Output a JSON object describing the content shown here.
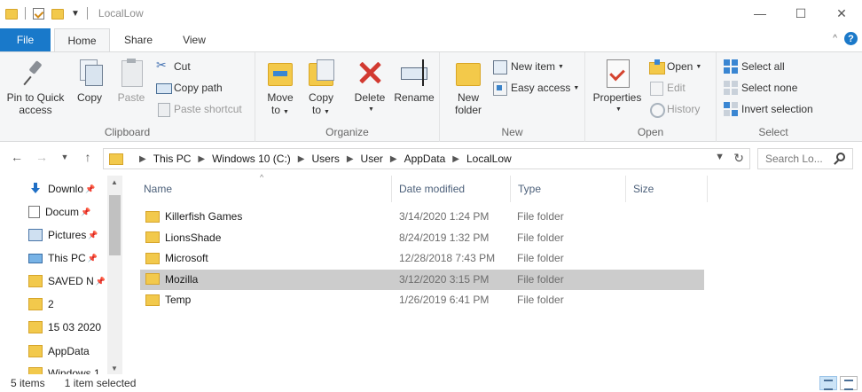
{
  "window": {
    "title": "LocalLow",
    "minimize_glyph": "—",
    "maximize_glyph": "☐",
    "close_glyph": "✕"
  },
  "tabs": [
    "File",
    "Home",
    "Share",
    "View"
  ],
  "help_glyph": "?",
  "ribbon_collapse_glyph": "^",
  "ribbon": {
    "clipboard": {
      "label": "Clipboard",
      "pin_line1": "Pin to Quick",
      "pin_line2": "access",
      "copy": "Copy",
      "paste": "Paste",
      "cut": "Cut",
      "copy_path": "Copy path",
      "paste_shortcut": "Paste shortcut"
    },
    "organize": {
      "label": "Organize",
      "move_line1": "Move",
      "move_line2": "to",
      "copy_line1": "Copy",
      "copy_line2": "to",
      "delete": "Delete",
      "rename": "Rename"
    },
    "new": {
      "label": "New",
      "new_folder_line1": "New",
      "new_folder_line2": "folder",
      "new_item": "New item",
      "easy_access": "Easy access"
    },
    "open": {
      "label": "Open",
      "properties": "Properties",
      "open": "Open",
      "edit": "Edit",
      "history": "History"
    },
    "select": {
      "label": "Select",
      "select_all": "Select all",
      "select_none": "Select none",
      "invert_selection": "Invert selection"
    }
  },
  "address": {
    "crumbs": [
      "This PC",
      "Windows 10 (C:)",
      "Users",
      "User",
      "AppData",
      "LocalLow"
    ],
    "search_placeholder": "Search Lo..."
  },
  "nav_pane": {
    "items": [
      {
        "label": "Downlo",
        "icon": "download-icon",
        "pinned": true
      },
      {
        "label": "Docum",
        "icon": "document-icon",
        "pinned": true
      },
      {
        "label": "Pictures",
        "icon": "pictures-icon",
        "pinned": true
      },
      {
        "label": "This PC",
        "icon": "this-pc-icon",
        "pinned": true
      },
      {
        "label": "SAVED N",
        "icon": "folder-icon",
        "pinned": true
      },
      {
        "label": "2",
        "icon": "folder-icon",
        "pinned": false
      },
      {
        "label": "15 03 2020",
        "icon": "folder-icon",
        "pinned": false
      },
      {
        "label": "AppData",
        "icon": "folder-icon",
        "pinned": false
      },
      {
        "label": "Windows 1",
        "icon": "folder-icon",
        "pinned": false
      }
    ]
  },
  "columns": [
    "Name",
    "Date modified",
    "Type",
    "Size"
  ],
  "files": [
    {
      "name": "Killerfish Games",
      "date": "3/14/2020 1:24 PM",
      "type": "File folder",
      "selected": false
    },
    {
      "name": "LionsShade",
      "date": "8/24/2019 1:32 PM",
      "type": "File folder",
      "selected": false
    },
    {
      "name": "Microsoft",
      "date": "12/28/2018 7:43 PM",
      "type": "File folder",
      "selected": false
    },
    {
      "name": "Mozilla",
      "date": "3/12/2020 3:15 PM",
      "type": "File folder",
      "selected": true
    },
    {
      "name": "Temp",
      "date": "1/26/2019 6:41 PM",
      "type": "File folder",
      "selected": false
    }
  ],
  "status": {
    "item_count": "5 items",
    "selection": "1 item selected"
  },
  "colors": {
    "file_tab": "#1979ca",
    "selected_row": "#cccccc",
    "folder": "#f2c94c"
  }
}
